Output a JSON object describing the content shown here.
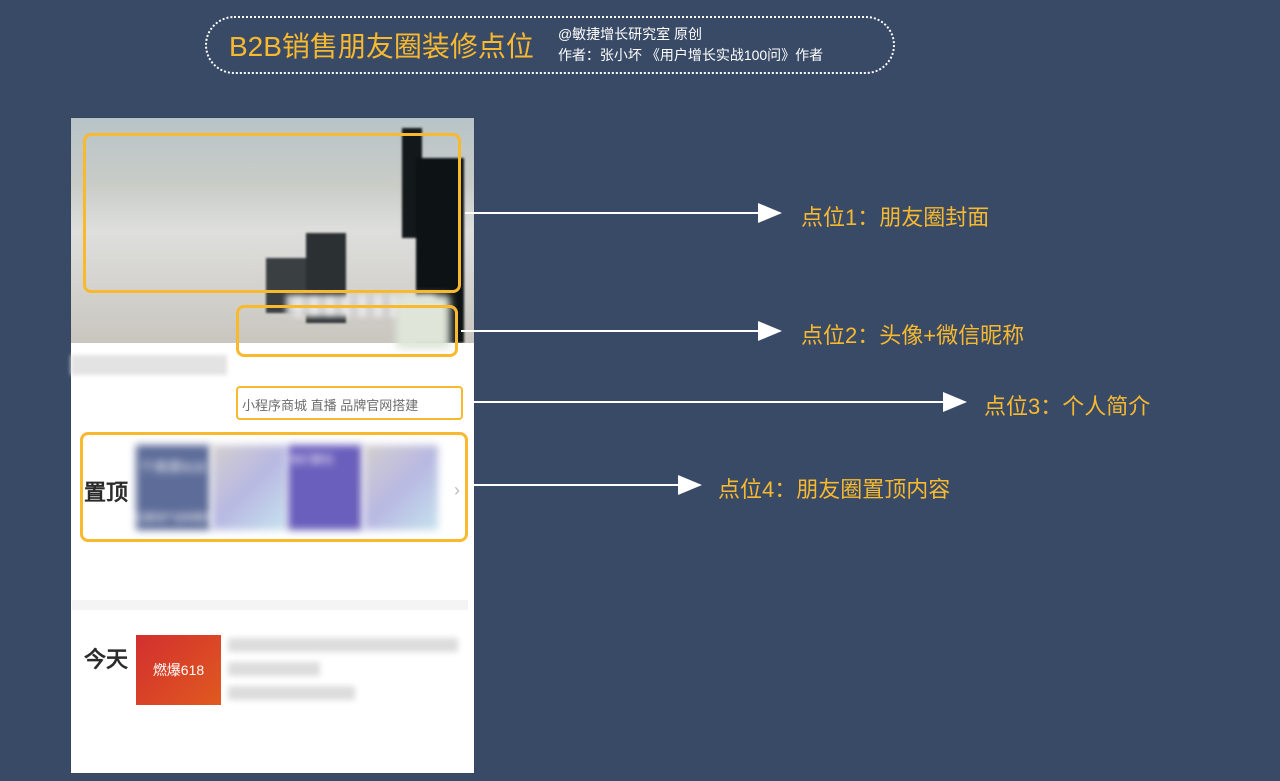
{
  "header": {
    "title": "B2B销售朋友圈装修点位",
    "sub_line1": "@敏捷增长研究室 原创",
    "sub_line2": "作者：张小坏  《用户增长实战100问》作者"
  },
  "mock": {
    "bio_text": "小程序商城 直播 品牌官网搭建",
    "pin_label": "置顶",
    "pin_thumb_text": "个商家618",
    "pin_thumb_text2": "位重视产品和服务的",
    "pin_thumb_side": "他们都在",
    "today_label": "今天",
    "today_thumb_text": "燃爆618"
  },
  "callouts": {
    "c1": "点位1：朋友圈封面",
    "c2": "点位2：头像+微信昵称",
    "c3": "点位3：个人简介",
    "c4": "点位4：朋友圈置顶内容"
  }
}
